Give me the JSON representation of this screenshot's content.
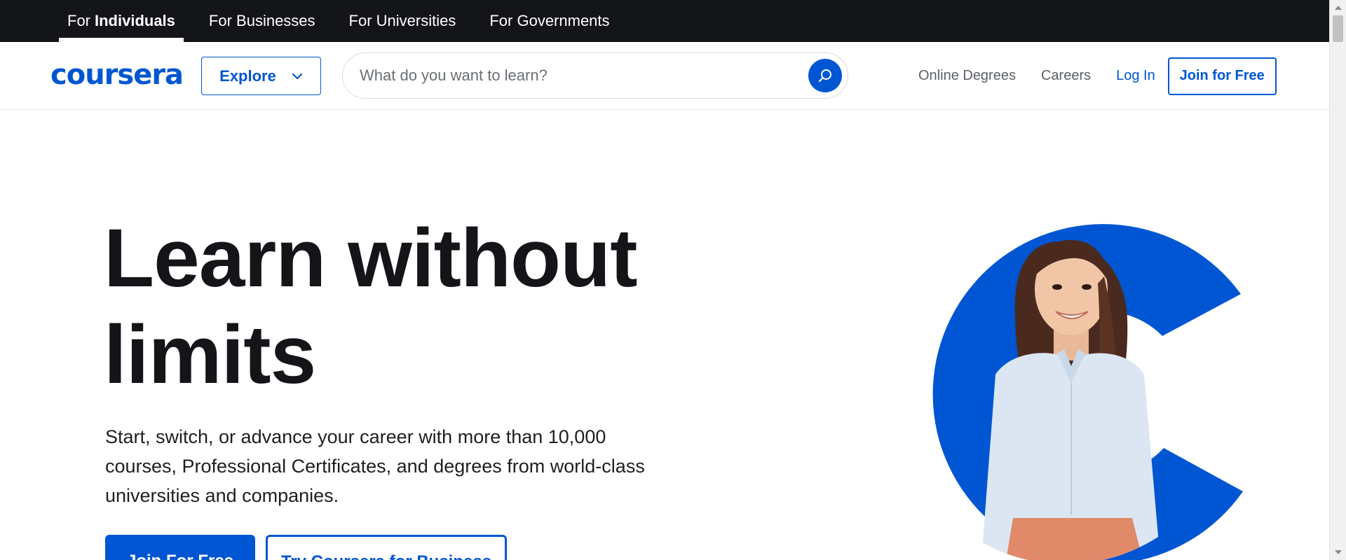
{
  "audience_nav": {
    "tabs": [
      {
        "prefix": "For",
        "strong": "Individuals",
        "label": "For Individuals",
        "active": true
      },
      {
        "label": "For Businesses",
        "active": false
      },
      {
        "label": "For Universities",
        "active": false
      },
      {
        "label": "For Governments",
        "active": false
      }
    ]
  },
  "header": {
    "logo_text": "coursera",
    "explore_label": "Explore",
    "search": {
      "placeholder": "What do you want to learn?",
      "value": ""
    },
    "links": {
      "online_degrees": "Online Degrees",
      "careers": "Careers",
      "login": "Log In",
      "join": "Join for Free"
    }
  },
  "hero": {
    "title_line1": "Learn without",
    "title_line2": "limits",
    "subtitle": "Start, switch, or advance your career with more than 10,000 courses, Professional Certificates, and degrees from world-class universities and companies.",
    "cta_primary": "Join For Free",
    "cta_secondary": "Try Coursera for Business"
  },
  "colors": {
    "brand": "#0056d2",
    "top_bar": "#141519"
  }
}
